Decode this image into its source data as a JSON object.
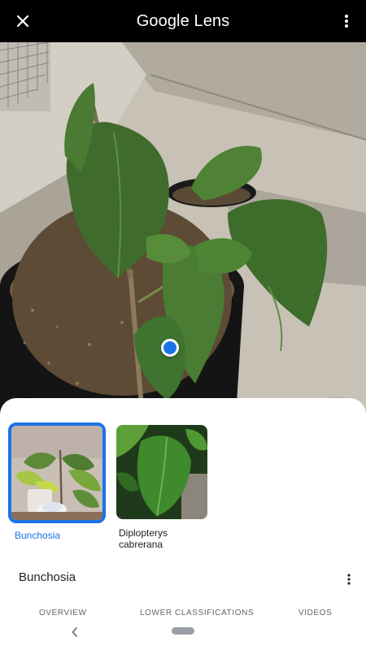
{
  "app": {
    "title_brand": "Google",
    "title_product": " Lens"
  },
  "icons": {
    "close": "close-icon",
    "overflow": "more-vert-icon",
    "filter": "filter-icon",
    "crop_search": "image-search-icon",
    "back": "chevron-left-icon"
  },
  "colors": {
    "accent": "#1a73e8",
    "topbar": "#000000"
  },
  "results": [
    {
      "label": "Bunchosia",
      "selected": true
    },
    {
      "label": "Diplopterys cabrerana",
      "selected": false
    }
  ],
  "entity": {
    "title": "Bunchosia"
  },
  "tabs": [
    {
      "label": "OVERVIEW"
    },
    {
      "label": "LOWER CLASSIFICATIONS"
    },
    {
      "label": "VIDEOS"
    }
  ]
}
